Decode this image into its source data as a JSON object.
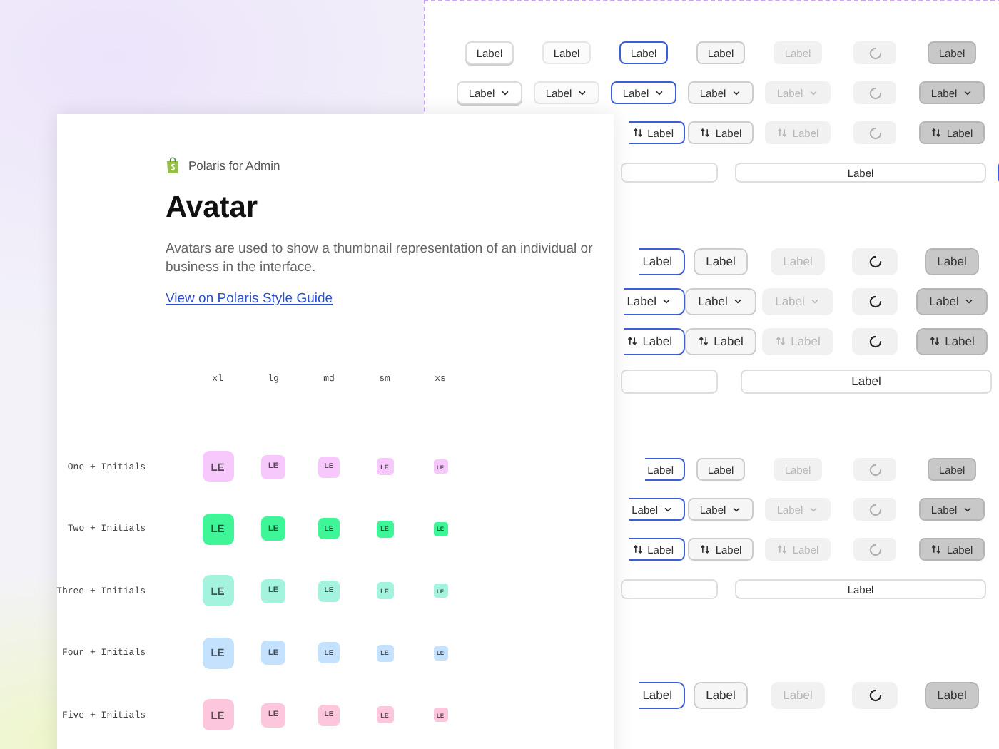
{
  "button_canvas": {
    "groups": [
      {
        "kind": "small",
        "rows": [
          {
            "kind": "plain",
            "buttons": [
              {
                "kind": "default",
                "label": "Label"
              },
              {
                "kind": "secondary",
                "label": "Label"
              },
              {
                "kind": "focused",
                "label": "Label"
              },
              {
                "kind": "pressed",
                "label": "Label"
              },
              {
                "kind": "disabled",
                "label": "Label"
              },
              {
                "kind": "loading"
              },
              {
                "kind": "selected",
                "label": "Label"
              }
            ]
          },
          {
            "kind": "dropdown",
            "buttons": [
              {
                "kind": "default",
                "label": "Label"
              },
              {
                "kind": "secondary",
                "label": "Label"
              },
              {
                "kind": "focused",
                "label": "Label"
              },
              {
                "kind": "pressed",
                "label": "Label"
              },
              {
                "kind": "disabled",
                "label": "Label"
              },
              {
                "kind": "loading"
              },
              {
                "kind": "selected",
                "label": "Label"
              }
            ]
          },
          {
            "kind": "sort",
            "buttons": [
              {
                "kind": "focused",
                "label": "Label"
              },
              {
                "kind": "pressed",
                "label": "Label"
              },
              {
                "kind": "disabled",
                "label": "Label"
              },
              {
                "kind": "loading"
              },
              {
                "kind": "selected",
                "label": "Label"
              }
            ]
          },
          {
            "kind": "wide",
            "buttons": [
              {
                "kind": "default"
              },
              {
                "kind": "default",
                "label": "Label"
              },
              {
                "kind": "focused"
              }
            ]
          }
        ]
      },
      {
        "kind": "medium",
        "rows": [
          {
            "kind": "plain",
            "buttons": [
              {
                "kind": "focused",
                "label": "Label"
              },
              {
                "kind": "pressed",
                "label": "Label"
              },
              {
                "kind": "disabled",
                "label": "Label"
              },
              {
                "kind": "loading"
              },
              {
                "kind": "selected",
                "label": "Label"
              }
            ]
          },
          {
            "kind": "dropdown",
            "buttons": [
              {
                "kind": "focused",
                "label": "Label"
              },
              {
                "kind": "pressed",
                "label": "Label"
              },
              {
                "kind": "disabled",
                "label": "Label"
              },
              {
                "kind": "loading"
              },
              {
                "kind": "selected",
                "label": "Label"
              }
            ]
          },
          {
            "kind": "sort",
            "buttons": [
              {
                "kind": "focused",
                "label": "Label"
              },
              {
                "kind": "pressed",
                "label": "Label"
              },
              {
                "kind": "disabled",
                "label": "Label"
              },
              {
                "kind": "loading"
              },
              {
                "kind": "selected",
                "label": "Label"
              }
            ]
          },
          {
            "kind": "wide",
            "buttons": [
              {
                "kind": "default"
              },
              {
                "kind": "default",
                "label": "Label"
              }
            ]
          }
        ]
      },
      {
        "kind": "small",
        "rows": [
          {
            "kind": "plain",
            "buttons": [
              {
                "kind": "focused",
                "label": "Label"
              },
              {
                "kind": "pressed",
                "label": "Label"
              },
              {
                "kind": "disabled",
                "label": "Label"
              },
              {
                "kind": "loading"
              },
              {
                "kind": "selected",
                "label": "Label"
              }
            ]
          },
          {
            "kind": "dropdown",
            "buttons": [
              {
                "kind": "focused",
                "label": "Label"
              },
              {
                "kind": "pressed",
                "label": "Label"
              },
              {
                "kind": "disabled",
                "label": "Label"
              },
              {
                "kind": "loading"
              },
              {
                "kind": "selected",
                "label": "Label"
              }
            ]
          },
          {
            "kind": "sort",
            "buttons": [
              {
                "kind": "focused",
                "label": "Label"
              },
              {
                "kind": "pressed",
                "label": "Label"
              },
              {
                "kind": "disabled",
                "label": "Label"
              },
              {
                "kind": "loading"
              },
              {
                "kind": "selected",
                "label": "Label"
              }
            ]
          },
          {
            "kind": "wide",
            "buttons": [
              {
                "kind": "default"
              },
              {
                "kind": "default",
                "label": "Label"
              }
            ]
          }
        ]
      },
      {
        "kind": "medium",
        "rows": [
          {
            "kind": "plain",
            "buttons": [
              {
                "kind": "focused",
                "label": "Label"
              },
              {
                "kind": "pressed",
                "label": "Label"
              },
              {
                "kind": "disabled",
                "label": "Label"
              },
              {
                "kind": "loading"
              },
              {
                "kind": "selected",
                "label": "Label"
              }
            ]
          }
        ]
      }
    ]
  },
  "doc_card": {
    "brand": "Polaris for Admin",
    "title": "Avatar",
    "description": "Avatars are used to show a thumbnail representation of an individual or business in the interface.",
    "link": "View on Polaris Style Guide",
    "table": {
      "columns": [
        "xl",
        "lg",
        "md",
        "sm",
        "xs"
      ],
      "rows": [
        {
          "label": "One + Initials",
          "color": "#f6c8fb",
          "avatars": [
            "LE",
            "LE",
            "LE",
            "LE",
            "LE"
          ]
        },
        {
          "label": "Two + Initials",
          "color": "#3ef598",
          "avatars": [
            "LE",
            "LE",
            "LE",
            "LE",
            "LE"
          ]
        },
        {
          "label": "Three + Initials",
          "color": "#a3f3df",
          "avatars": [
            "LE",
            "LE",
            "LE",
            "LE",
            "LE"
          ]
        },
        {
          "label": "Four + Initials",
          "color": "#c4e1fd",
          "avatars": [
            "LE",
            "LE",
            "LE",
            "LE",
            "LE"
          ]
        },
        {
          "label": "Five + Initials",
          "color": "#fcc7dc",
          "avatars": [
            "LE",
            "LE",
            "LE",
            "LE",
            "LE"
          ]
        }
      ]
    }
  }
}
